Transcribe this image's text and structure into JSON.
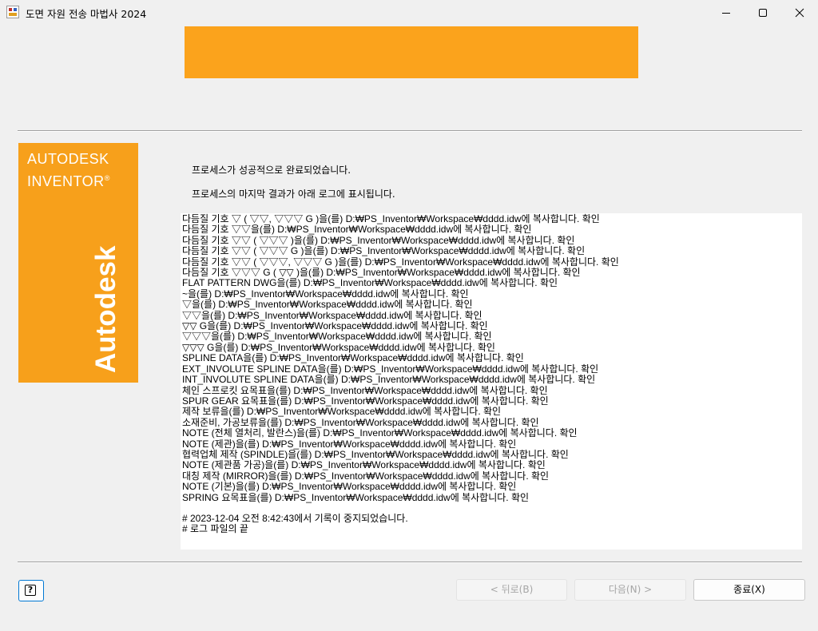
{
  "window": {
    "title": "도면 자원 전송 마법사 2024",
    "icon": "app-icon",
    "controls": [
      "minimize-icon",
      "maximize-icon",
      "close-icon"
    ]
  },
  "brand": {
    "line1": "AUTODESK",
    "line2": "INVENTOR",
    "registered": "®",
    "vertical": "Autodesk",
    "color": "#f7a01b"
  },
  "banner": {
    "color": "#fba31c"
  },
  "messages": {
    "status": "프로세스가 성공적으로 완료되었습니다.",
    "note": "프로세스의 마지막 결과가 아래 로그에 표시됩니다."
  },
  "log": {
    "lines": [
      "다듬질 기호 ▽ ( ▽▽, ▽▽▽ G )을(를) D:₩PS_Inventor₩Workspace₩dddd.idw에 복사합니다. 확인",
      "다듬질 기호 ▽▽을(를) D:₩PS_Inventor₩Workspace₩dddd.idw에 복사합니다. 확인",
      "다듬질 기호 ▽▽ ( ▽▽▽ )을(를) D:₩PS_Inventor₩Workspace₩dddd.idw에 복사합니다. 확인",
      "다듬질 기호 ▽▽ ( ▽▽▽ G )을(를) D:₩PS_Inventor₩Workspace₩dddd.idw에 복사합니다. 확인",
      "다듬질 기호 ▽▽ ( ▽▽▽, ▽▽▽ G )을(를) D:₩PS_Inventor₩Workspace₩dddd.idw에 복사합니다. 확인",
      "다듬질 기호 ▽▽▽ G ( ▽▽ )을(를) D:₩PS_Inventor₩Workspace₩dddd.idw에 복사합니다. 확인",
      "FLAT PATTERN DWG을(를) D:₩PS_Inventor₩Workspace₩dddd.idw에 복사합니다. 확인",
      "~을(를) D:₩PS_Inventor₩Workspace₩dddd.idw에 복사합니다. 확인",
      "▽을(를) D:₩PS_Inventor₩Workspace₩dddd.idw에 복사합니다. 확인",
      "▽▽을(를) D:₩PS_Inventor₩Workspace₩dddd.idw에 복사합니다. 확인",
      "▽▽ G을(를) D:₩PS_Inventor₩Workspace₩dddd.idw에 복사합니다. 확인",
      "▽▽▽을(를) D:₩PS_Inventor₩Workspace₩dddd.idw에 복사합니다. 확인",
      "▽▽▽ G을(를) D:₩PS_Inventor₩Workspace₩dddd.idw에 복사합니다. 확인",
      "SPLINE DATA을(를) D:₩PS_Inventor₩Workspace₩dddd.idw에 복사합니다. 확인",
      "EXT_INVOLUTE SPLINE DATA을(를) D:₩PS_Inventor₩Workspace₩dddd.idw에 복사합니다. 확인",
      "INT_INVOLUTE SPLINE DATA을(를) D:₩PS_Inventor₩Workspace₩dddd.idw에 복사합니다. 확인",
      "체인 스프로킷 요목표을(를) D:₩PS_Inventor₩Workspace₩dddd.idw에 복사합니다. 확인",
      "SPUR GEAR 요목표을(를) D:₩PS_Inventor₩Workspace₩dddd.idw에 복사합니다. 확인",
      "제작 보류을(를) D:₩PS_Inventor₩Workspace₩dddd.idw에 복사합니다. 확인",
      "소재준비, 가공보류을(를) D:₩PS_Inventor₩Workspace₩dddd.idw에 복사합니다. 확인",
      "NOTE (전체 열처리, 발란스)을(를) D:₩PS_Inventor₩Workspace₩dddd.idw에 복사합니다. 확인",
      "NOTE (제관)을(를) D:₩PS_Inventor₩Workspace₩dddd.idw에 복사합니다. 확인",
      "협력업체 제작 (SPINDLE)을(를) D:₩PS_Inventor₩Workspace₩dddd.idw에 복사합니다. 확인",
      "NOTE (제관품 가공)을(를) D:₩PS_Inventor₩Workspace₩dddd.idw에 복사합니다. 확인",
      "대칭 제작 (MIRROR)을(를) D:₩PS_Inventor₩Workspace₩dddd.idw에 복사합니다. 확인",
      "NOTE (기본)을(를) D:₩PS_Inventor₩Workspace₩dddd.idw에 복사합니다. 확인",
      "SPRING 요목표을(를) D:₩PS_Inventor₩Workspace₩dddd.idw에 복사합니다. 확인"
    ],
    "footer": [
      "# 2023-12-04 오전 8:42:43에서 기록이 중지되었습니다.",
      "# 로그 파일의 끝"
    ]
  },
  "buttons": {
    "help": "?",
    "back": "< 뒤로(B)",
    "next": "다음(N) >",
    "finish": "종료(X)"
  }
}
